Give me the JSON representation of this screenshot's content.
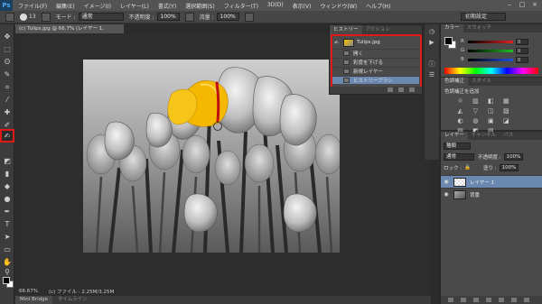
{
  "app": {
    "logo": "Ps"
  },
  "menu": [
    "ファイル(F)",
    "編集(E)",
    "イメージ(I)",
    "レイヤー(L)",
    "書式(Y)",
    "選択範囲(S)",
    "フィルター(T)",
    "3D(D)",
    "表示(V)",
    "ウィンドウ(W)",
    "ヘルプ(H)"
  ],
  "window_controls": [
    "–",
    "□",
    "×"
  ],
  "options": {
    "brush_size": "13",
    "mode_label": "モード :",
    "mode_value": "通常",
    "opacity_label": "不透明度 :",
    "opacity_value": "100%",
    "flow_label": "流量 :",
    "flow_value": "100%",
    "workspace": "初期設定"
  },
  "document": {
    "tab": "(c) Tulips.jpg @ 66.7% (レイヤー 1, RGB/8#) *",
    "zoom": "66.67%",
    "file_info": "(c) ファイル : 2.25M/3.25M"
  },
  "bottom_tabs": [
    "Mini Bridge",
    "タイムライン"
  ],
  "history": {
    "tabs": [
      "ヒストリー",
      "アクション"
    ],
    "snapshot": "Tulips.jpg",
    "items": [
      {
        "label": "開く",
        "selected": false
      },
      {
        "label": "彩度を下げる",
        "selected": false
      },
      {
        "label": "新規レイヤー",
        "selected": false
      },
      {
        "label": "ヒストリーブラシ",
        "selected": true
      }
    ]
  },
  "color_panel": {
    "tabs": [
      "カラー",
      "スウォッチ"
    ],
    "channels": [
      {
        "name": "R",
        "value": "0",
        "color": "#e02020"
      },
      {
        "name": "G",
        "value": "0",
        "color": "#20c020"
      },
      {
        "name": "B",
        "value": "0",
        "color": "#2050e0"
      }
    ]
  },
  "adjust_panel": {
    "tabs": [
      "色調補正",
      "スタイル"
    ],
    "title": "色調補正を追加",
    "icons": [
      "☼",
      "▥",
      "◧",
      "▦",
      "◭",
      "▽",
      "◫",
      "▨",
      "◐",
      "◍",
      "▣",
      "◪",
      "▤",
      "◩",
      "▧"
    ]
  },
  "layers_panel": {
    "tabs": [
      "レイヤー",
      "チャンネル",
      "パス"
    ],
    "kind_label": "種類",
    "blend_mode": "通常",
    "opacity_label": "不透明度 :",
    "opacity_value": "100%",
    "lock_label": "ロック :",
    "fill_label": "塗り :",
    "fill_value": "100%",
    "layers": [
      {
        "name": "レイヤー 1",
        "selected": true
      },
      {
        "name": "背景",
        "selected": false
      }
    ]
  },
  "colors": {
    "accent_red": "#e01818",
    "selection_blue": "#6a88b0",
    "panel_bg": "#4a4a4a",
    "tulip_yellow": "#f5b800"
  }
}
